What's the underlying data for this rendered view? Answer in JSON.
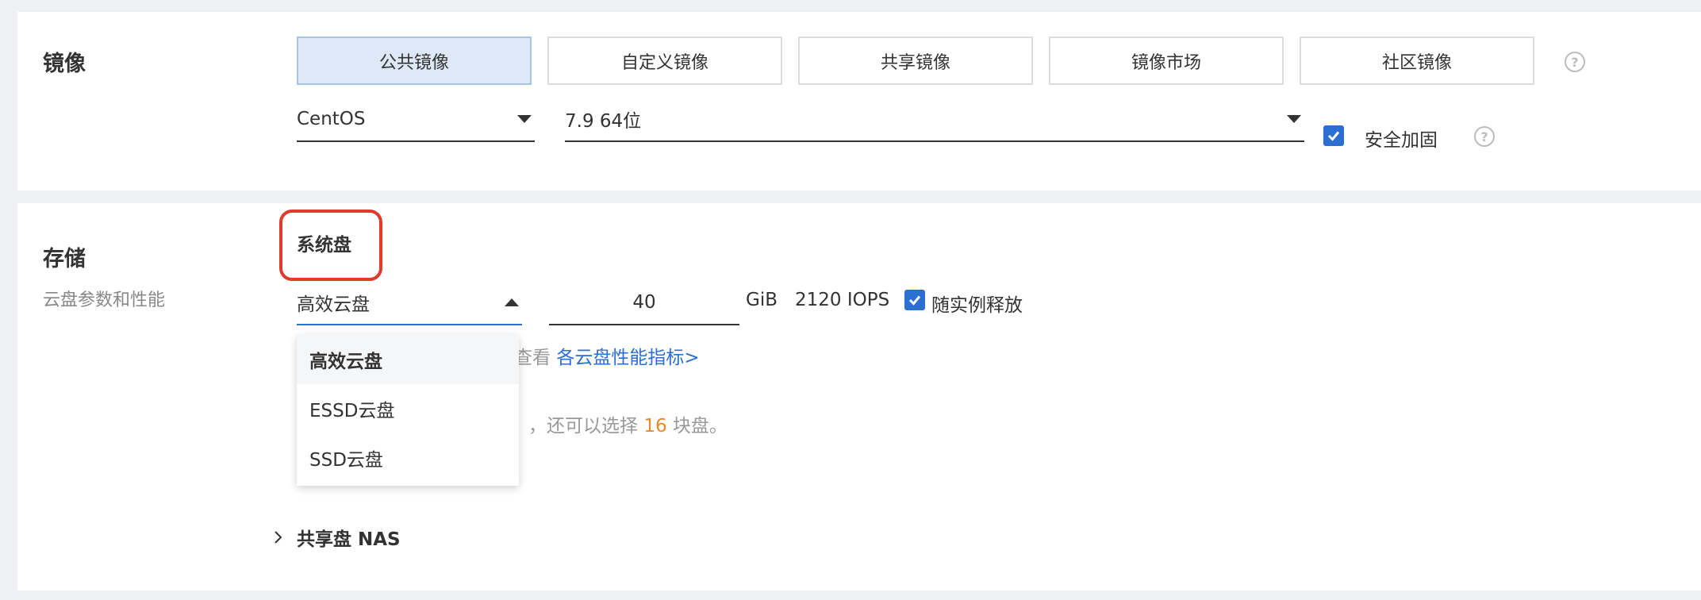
{
  "image_section": {
    "title": "镜像",
    "tabs": [
      "公共镜像",
      "自定义镜像",
      "共享镜像",
      "镜像市场",
      "社区镜像"
    ],
    "os_select": "CentOS",
    "version_select": "7.9 64位",
    "security_label": "安全加固"
  },
  "storage_section": {
    "title": "存储",
    "subtitle": "云盘参数和性能",
    "system_disk_label": "系统盘",
    "disk_type": "高效云盘",
    "size": "40",
    "unit": "GiB",
    "iops": "2120 IOPS",
    "release_label": "随实例释放",
    "perf_prefix": "查看",
    "perf_link": "各云盘性能指标>",
    "remaining_prefix": "，还可以选择",
    "remaining_count": "16",
    "remaining_suffix": "块盘。",
    "nas_label": "共享盘 NAS",
    "dropdown_options": [
      "高效云盘",
      "ESSD云盘",
      "SSD云盘"
    ]
  },
  "colors": {
    "accent": "#2b6fd0",
    "highlight": "#e03a2a",
    "count": "#e8892b"
  }
}
